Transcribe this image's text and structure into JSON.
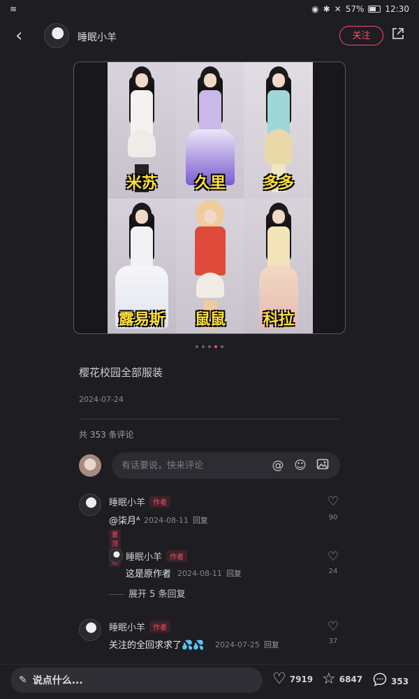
{
  "status": {
    "battery": "57%",
    "time": "12:30"
  },
  "header": {
    "username": "睡眠小羊",
    "follow_label": "关注"
  },
  "image": {
    "labels": [
      "米苏",
      "久里",
      "多多",
      "露易斯",
      "鼠鼠",
      "科拉"
    ],
    "page_count": 5,
    "active_page": 4
  },
  "post": {
    "caption": "樱花校园全部服装",
    "date": "2024-07-24"
  },
  "comments_section": {
    "count_label": "共 353 条评论",
    "input_placeholder": "有话要说，快来评论"
  },
  "comments": [
    {
      "name": "睡眠小羊",
      "badge": "作者",
      "text": "@柒月ᴬ",
      "date": "2024-08-11",
      "reply": "回复",
      "pinned": "置顶评论",
      "likes": "90"
    },
    {
      "name": "睡眠小羊",
      "badge": "作者",
      "text": "这是原作者",
      "date": "2024-08-11",
      "reply": "回复",
      "likes": "24"
    },
    {
      "name": "睡眠小羊",
      "badge": "作者",
      "text": "关注的全回求求了💦💦",
      "date": "2024-07-25",
      "reply": "回复",
      "likes": "37"
    }
  ],
  "expand_label": "展开 5 条回复",
  "bottom": {
    "say_placeholder": "说点什么...",
    "likes": "7919",
    "stars": "6847",
    "comments": "353"
  },
  "colors": {
    "accent": "#ff4a6d",
    "background": "#1d1d22",
    "label_yellow": "#ffe13a"
  }
}
